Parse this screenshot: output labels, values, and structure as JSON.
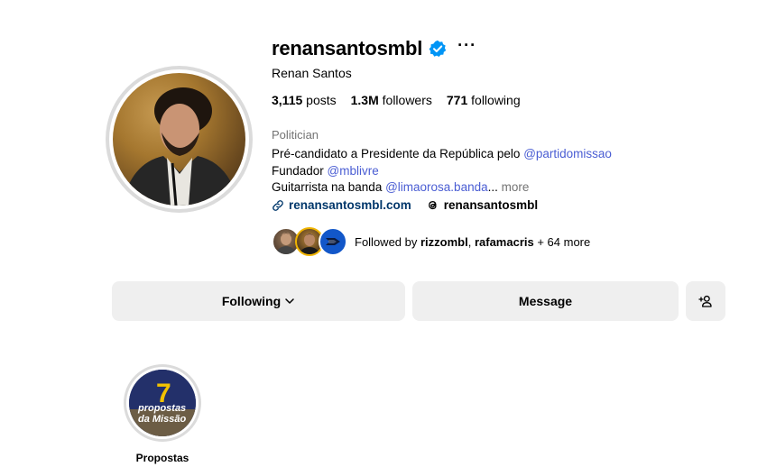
{
  "profile": {
    "username": "renansantosmbl",
    "full_name": "Renan Santos",
    "more_glyph": "···",
    "stats": {
      "posts_count": "3,115",
      "posts_label": "posts",
      "followers_count": "1.3M",
      "followers_label": "followers",
      "following_count": "771",
      "following_label": "following"
    },
    "category": "Politician",
    "bio": {
      "line1_text": "Pré-candidato a Presidente da República pelo ",
      "line1_mention": "@partidomissao",
      "line2_text": "Fundador ",
      "line2_mention": "@mblivre",
      "line3_text": "Guitarrista na banda ",
      "line3_mention": "@limaorosa.banda",
      "line3_ellipsis": "... ",
      "more_label": "more"
    },
    "link_label": "renansantosmbl.com",
    "threads_label": "renansantosmbl",
    "followed_by": {
      "prefix": "Followed by ",
      "user1": "rizzombl",
      "separator": ", ",
      "user2": "rafamacris",
      "suffix": " + 64 more"
    }
  },
  "actions": {
    "following_label": "Following",
    "message_label": "Message"
  },
  "highlights": [
    {
      "label": "Propostas",
      "cover_text_1": "7",
      "cover_text_2": "propostas",
      "cover_text_3": "da Missão"
    }
  ],
  "colors": {
    "verified": "#0095f6",
    "mention": "#4a5dd3",
    "link": "#00376b",
    "button_bg": "#efefef",
    "muted": "#737373"
  },
  "icons": {
    "verified": "verified-badge-icon",
    "more": "more-options-icon",
    "link": "link-icon",
    "threads": "threads-icon",
    "chevron": "chevron-down-icon",
    "add_user": "add-user-icon"
  }
}
